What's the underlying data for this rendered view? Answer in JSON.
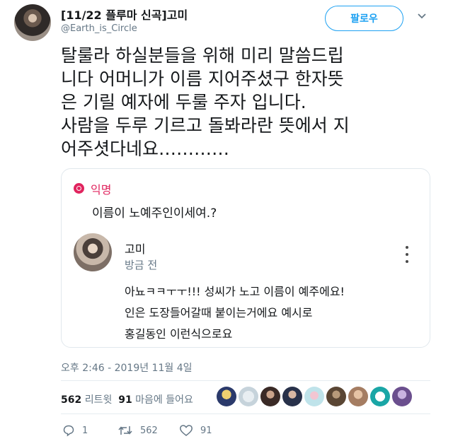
{
  "author": {
    "display_name": "[11/22 플루마 신곡]고미",
    "handle": "@Earth_is_Circle"
  },
  "follow_label": "팔로우",
  "tweet_lines": [
    "탈룰라 하실분들을 위해 미리 말씀드립",
    "니다 어머니가 이름 지어주셨구 한자뜻",
    "은 기릴 예자에 두룰 주자 입니다.",
    "사람을 두루 기르고 돌봐라란 뜻에서 지",
    "어주셧다네요…………"
  ],
  "quote": {
    "anon_label": "익명",
    "question": "이름이 노예주인이세여.?",
    "reply_name": "고미",
    "reply_time": "방금 전",
    "reply_lines": [
      "아뇨ㅋㅋㅜㅜ!!! 성씨가 노고 이름이 예주에요!",
      "인은 도장들어갈때 붙이는거에요 예시로",
      "홍길동인 이런식으로요"
    ]
  },
  "timestamp": "오후 2:46 - 2019년 11월 4일",
  "stats": {
    "retweets_count": "562",
    "retweets_label": "리트윗",
    "likes_count": "91",
    "likes_label": "마음에 들어요"
  },
  "actions": {
    "reply_count": "1",
    "retweet_count": "562",
    "like_count": "91"
  },
  "colors": {
    "accent": "#1da1f2",
    "anon": "#e0245e",
    "muted": "#657786"
  }
}
